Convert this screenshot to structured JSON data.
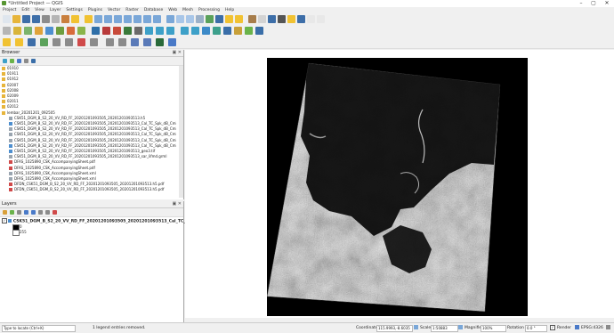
{
  "window": {
    "title": "*Untitled Project — QGIS",
    "minimize": "–",
    "maximize": "▢",
    "close": "✕"
  },
  "menu": [
    "Project",
    "Edit",
    "View",
    "Layer",
    "Settings",
    "Plugins",
    "Vector",
    "Raster",
    "Database",
    "Web",
    "Mesh",
    "Processing",
    "Help"
  ],
  "toolbar_icons": {
    "row1": [
      {
        "name": "new-project-icon",
        "color": "#dfe6ee"
      },
      {
        "name": "open-project-icon",
        "color": "#e7b53b"
      },
      {
        "name": "save-project-icon",
        "color": "#3d6ea8"
      },
      {
        "name": "save-as-icon",
        "color": "#3d6ea8"
      },
      {
        "name": "print-layout-icon",
        "color": "#8c8c8c"
      },
      {
        "name": "layout-manager-icon",
        "color": "#b5b5b5"
      },
      {
        "name": "style-manager-icon",
        "color": "#c97f3d"
      },
      {
        "name": "pan-icon",
        "color": "#f1c232"
      },
      {
        "name": "pan-to-selection-icon",
        "color": "#f1c232"
      },
      {
        "name": "zoom-in-icon",
        "color": "#7aa7d8"
      },
      {
        "name": "zoom-out-icon",
        "color": "#7aa7d8"
      },
      {
        "name": "zoom-native-icon",
        "color": "#7aa7d8"
      },
      {
        "name": "zoom-full-icon",
        "color": "#7aa7d8"
      },
      {
        "name": "zoom-to-selection-icon",
        "color": "#7aa7d8"
      },
      {
        "name": "zoom-to-layer-icon",
        "color": "#7aa7d8"
      },
      {
        "name": "zoom-last-icon",
        "color": "#7aa7d8"
      },
      {
        "name": "zoom-next-icon",
        "color": "#7aa7d8"
      },
      {
        "name": "new-map-view-icon",
        "color": "#a8c6e8"
      },
      {
        "name": "new-3d-view-icon",
        "color": "#a8c6e8"
      },
      {
        "name": "temporal-icon",
        "color": "#9bb0c8"
      },
      {
        "name": "refresh-icon",
        "color": "#5aa15a"
      },
      {
        "name": "identify-icon",
        "color": "#3d6ea8"
      },
      {
        "name": "select-icon",
        "color": "#f1c232"
      },
      {
        "name": "deselect-icon",
        "color": "#f1c232"
      },
      {
        "name": "field-calc-icon",
        "color": "#a77d4b"
      },
      {
        "name": "attribute-table-icon",
        "color": "#d3d3d3"
      },
      {
        "name": "statistics-icon",
        "color": "#3d6ea8"
      },
      {
        "name": "measure-icon",
        "color": "#555555"
      },
      {
        "name": "map-tips-icon",
        "color": "#f1c232"
      },
      {
        "name": "bookmark-icon",
        "color": "#3d6ea8"
      },
      {
        "name": "annotation-icon",
        "color": "#e8e8e8"
      },
      {
        "name": "text-annotation-icon",
        "color": "#e8e8e8"
      }
    ],
    "row2": [
      {
        "name": "data-source-manager-icon",
        "color": "#b5b5b5"
      },
      {
        "name": "new-geopackage-icon",
        "color": "#d8b43a"
      },
      {
        "name": "new-shapefile-icon",
        "color": "#7ab36b"
      },
      {
        "name": "add-vector-icon",
        "color": "#e0a33a"
      },
      {
        "name": "add-raster-icon",
        "color": "#4e8fcf"
      },
      {
        "name": "add-mesh-icon",
        "color": "#6e9e3e"
      },
      {
        "name": "add-delimited-icon",
        "color": "#d86b3a"
      },
      {
        "name": "add-spatialite-icon",
        "color": "#8bb54a"
      },
      {
        "name": "add-postgis-icon",
        "color": "#2f6fa8"
      },
      {
        "name": "add-mssql-icon",
        "color": "#b83a3a"
      },
      {
        "name": "add-oracle-icon",
        "color": "#c84a3a"
      },
      {
        "name": "add-db2-icon",
        "color": "#3a7a3a"
      },
      {
        "name": "add-virtual-layer-icon",
        "color": "#6a6a6a"
      },
      {
        "name": "add-wms-icon",
        "color": "#3da0c8"
      },
      {
        "name": "add-wcs-icon",
        "color": "#3da0c8"
      },
      {
        "name": "add-wfs-icon",
        "color": "#3da0c8"
      },
      {
        "name": "add-xyz-icon",
        "color": "#3da0c8"
      },
      {
        "name": "add-vector-tile-icon",
        "color": "#3da0c8"
      },
      {
        "name": "add-arcgis-icon",
        "color": "#3d8ac8"
      },
      {
        "name": "add-geonode-icon",
        "color": "#3da08c"
      },
      {
        "name": "python-console-icon",
        "color": "#3a6ea8"
      },
      {
        "name": "plugin-icon",
        "color": "#c8a03a"
      },
      {
        "name": "processing-toolbox-icon",
        "color": "#6ab34a"
      },
      {
        "name": "help-icon",
        "color": "#3a6ea8"
      }
    ],
    "row3": [
      {
        "name": "digitize-edit-icon",
        "color": "#f1c232"
      },
      {
        "name": "toggle-editing-icon",
        "color": "#f1c232"
      },
      {
        "name": "save-edits-icon",
        "color": "#3d6ea8"
      },
      {
        "name": "add-feature-icon",
        "color": "#5aa15a"
      },
      {
        "name": "vertex-tool-icon",
        "color": "#8b8b8b"
      },
      {
        "name": "move-feature-icon",
        "color": "#8b8b8b"
      },
      {
        "name": "delete-feature-icon",
        "color": "#d04a4a"
      },
      {
        "name": "cut-feature-icon",
        "color": "#8b8b8b"
      },
      {
        "name": "copy-feature-icon",
        "color": "#8b8b8b"
      },
      {
        "name": "paste-feature-icon",
        "color": "#8b8b8b"
      },
      {
        "name": "undo-icon",
        "color": "#5a7ab8"
      },
      {
        "name": "redo-icon",
        "color": "#5a7ab8"
      },
      {
        "name": "raster-calc-icon",
        "color": "#2a6a3a"
      },
      {
        "name": "histogram-icon",
        "color": "#4a7ac8"
      }
    ]
  },
  "browser": {
    "title": "Browser",
    "items": [
      "01910",
      "01911",
      "01912",
      "02007",
      "02008",
      "02009",
      "02011",
      "02012",
      "lembar_20201201_092505",
      "CSK51_DGM_B_S2_20_VV_RD_FF_20201201093505_20201201093513.h5",
      "CSK51_DGM_B_S2_20_VV_RD_FF_20201201093505_20201201093513_Cal_TC_Spk_dB_Cmi.tif",
      "CSK51_DGM_B_S2_20_VV_RD_FF_20201201093505_20201201093513_Cal_TC_Spk_dB_Cmi.xml",
      "CSK51_DGM_B_S2_20_VV_RD_FF_20201201093505_20201201093513_Cal_TC_Spk_dB_Cmi.vrml",
      "CSK51_DGM_B_S2_20_VV_RD_FF_20201201093505_20201201093513_Cal_TC_Spk_dB_Cmi.xml",
      "CSK51_DGM_B_S2_20_VV_RD_FF_20201201093505_20201201093513_Cal_TC_Spk_dB_Cmi_binary.tif",
      "CSK51_DGM_B_S2_20_VV_RD_FF_20201201093505_20201201093513_geo3.tif",
      "CSK51_DGM_B_S2_20_VV_RD_FF_20201201093505_20201201093513_sar_lifmd.grml",
      "DFAS_1025890_CSK_AccompanyingSheet.pdf",
      "DFAS_1025890_CSK_AccompanyingSheet.pdf",
      "DFAS_1025890_CSK_AccompanyingSheet.xml",
      "DFAS_1025890_CSK_AccompanyingSheet.xml",
      "DFDN_CSK51_DGM_B_S2_20_VV_RD_FF_20201201093505_20201201093513.h5.pdf",
      "DFDN_CSK51_DGM_B_S2_20_VV_RD_FF_20201201093505_20201201093513.h5.pdf"
    ]
  },
  "layers": {
    "title": "Layers",
    "layer_name": "CSK51_DGM_B_S2_20_VV_RD_FF_20201201093505_20201201093513_Cal_TC_Spk_dB_Cm",
    "legend_min": "0",
    "legend_max": "255"
  },
  "status": {
    "locator_placeholder": "Type to locate (Ctrl+K)",
    "message": "1 legend entries removed.",
    "coordinate_label": "Coordinate",
    "coordinate_value": "115.9993,-8.6035",
    "scale_label": "Scale",
    "scale_value": "1:50883",
    "magnifier_label": "Magnifier",
    "magnifier_value": "100%",
    "rotation_label": "Rotation",
    "rotation_value": "0.0 °",
    "render_label": "Render",
    "crs_label": "EPSG:4326"
  }
}
